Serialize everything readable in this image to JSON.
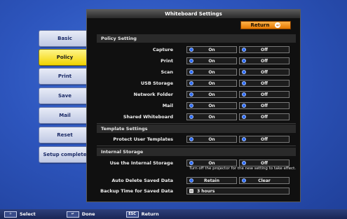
{
  "window": {
    "title": "Whiteboard Settings",
    "return_label": "Return"
  },
  "menu": [
    {
      "label": "Basic"
    },
    {
      "label": "Policy"
    },
    {
      "label": "Print"
    },
    {
      "label": "Save"
    },
    {
      "label": "Mail"
    },
    {
      "label": "Reset"
    },
    {
      "label": "Setup complete"
    }
  ],
  "policy": {
    "heading": "Policy Setting",
    "rows": [
      {
        "label": "Capture",
        "on": "On",
        "off": "Off"
      },
      {
        "label": "Print",
        "on": "On",
        "off": "Off"
      },
      {
        "label": "Scan",
        "on": "On",
        "off": "Off"
      },
      {
        "label": "USB Storage",
        "on": "On",
        "off": "Off"
      },
      {
        "label": "Network Folder",
        "on": "On",
        "off": "Off"
      },
      {
        "label": "Mail",
        "on": "On",
        "off": "Off"
      },
      {
        "label": "Shared Whiteboard",
        "on": "On",
        "off": "Off"
      }
    ]
  },
  "template": {
    "heading": "Template Settings",
    "rows": [
      {
        "label": "Protect User Templates",
        "on": "On",
        "off": "Off"
      }
    ]
  },
  "storage": {
    "heading": "Internal Storage",
    "use_label": "Use the Internal Storage",
    "use_on": "On",
    "use_off": "Off",
    "note": "Turn off the projector for the new setting to take effect.",
    "auto_delete_label": "Auto Delete Saved Data",
    "retain": "Retain",
    "clear": "Clear",
    "backup_label": "Backup Time for Saved Data",
    "backup_value": "3 hours"
  },
  "bottom_bar": {
    "select_key": "✧",
    "select": "Select",
    "done_key": "↵",
    "done": "Done",
    "esc_key": "ESC",
    "return": "Return"
  },
  "colors": {
    "background": "#2d55bd",
    "panel": "#101010",
    "active_menu": "#f1d300",
    "return_button": "#e57800",
    "radio_mark": "#2c6cff"
  }
}
